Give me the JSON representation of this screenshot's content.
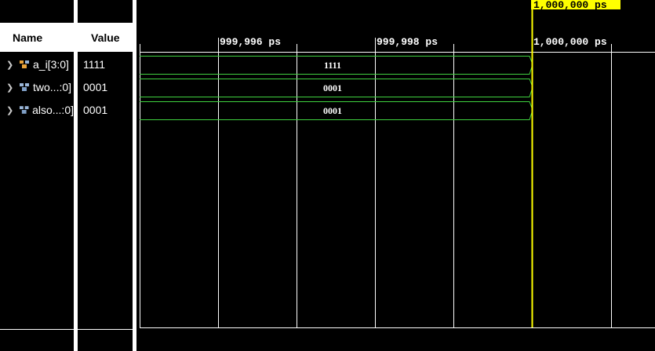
{
  "columns": {
    "name_label": "Name",
    "value_label": "Value"
  },
  "signals": [
    {
      "name": "a_i[3:0]",
      "value": "1111",
      "icon": "bus-signal-icon-orange",
      "wave_value": "1111"
    },
    {
      "name": "two...:0]",
      "value": "0001",
      "icon": "bus-signal-icon-blue",
      "wave_value": "0001"
    },
    {
      "name": "also...:0]",
      "value": "0001",
      "icon": "bus-signal-icon-blue",
      "wave_value": "0001"
    }
  ],
  "timeline": {
    "tick_labels": [
      "999,996 ps",
      "999,998 ps",
      "1,000,000 ps"
    ],
    "cursor_label": "1,000,000 ps"
  },
  "colors": {
    "wave": "#3fd13f",
    "cursor": "#ffff00",
    "grid": "#ffffff"
  }
}
